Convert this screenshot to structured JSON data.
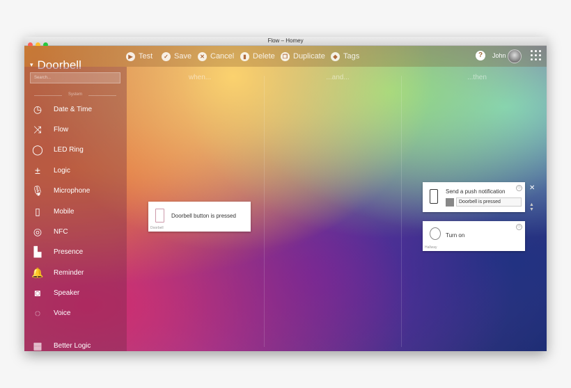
{
  "window": {
    "title": "Flow – Homey"
  },
  "header": {
    "app_name": "Doorbell"
  },
  "toolbar": [
    {
      "label": "Test",
      "icon": "play-icon",
      "glyph": "▶"
    },
    {
      "label": "Save",
      "icon": "check-icon",
      "glyph": "✓"
    },
    {
      "label": "Cancel",
      "icon": "close-icon",
      "glyph": "✕"
    },
    {
      "label": "Delete",
      "icon": "trash-icon",
      "glyph": "▮"
    },
    {
      "label": "Duplicate",
      "icon": "duplicate-icon",
      "glyph": "❐"
    },
    {
      "label": "Tags",
      "icon": "tag-icon",
      "glyph": "◆"
    }
  ],
  "user": {
    "name": "John",
    "help": "?"
  },
  "sidebar": {
    "search_placeholder": "Search...",
    "section_label": "System",
    "items": [
      {
        "label": "Date & Time",
        "icon": "clock-icon",
        "glyph": "◷"
      },
      {
        "label": "Flow",
        "icon": "flow-icon",
        "glyph": "⤨"
      },
      {
        "label": "LED Ring",
        "icon": "led-ring-icon",
        "glyph": "◯"
      },
      {
        "label": "Logic",
        "icon": "logic-icon",
        "glyph": "±"
      },
      {
        "label": "Microphone",
        "icon": "microphone-icon",
        "glyph": "🎙"
      },
      {
        "label": "Mobile",
        "icon": "mobile-icon",
        "glyph": "▯"
      },
      {
        "label": "NFC",
        "icon": "nfc-icon",
        "glyph": "◎"
      },
      {
        "label": "Presence",
        "icon": "map-icon",
        "glyph": "▙"
      },
      {
        "label": "Reminder",
        "icon": "bell-icon",
        "glyph": "🔔"
      },
      {
        "label": "Speaker",
        "icon": "speaker-icon",
        "glyph": "◙"
      },
      {
        "label": "Voice",
        "icon": "speech-bubble-icon",
        "glyph": "◌"
      },
      {
        "label": "Better Logic",
        "icon": "calculator-icon",
        "glyph": "▦"
      }
    ]
  },
  "columns": {
    "when": "when...",
    "and": "...and...",
    "then": "...then"
  },
  "cards": {
    "when": {
      "title": "Doorbell button is pressed",
      "caption": "Doorbell"
    },
    "then1": {
      "title": "Send a push notification",
      "value": "Doorbell is pressed"
    },
    "then2": {
      "title": "Turn on",
      "caption": "Hallway"
    }
  },
  "colors": {
    "accent": "#e48b3c",
    "titlebar_red": "#ff5f56",
    "titlebar_yellow": "#ffbd2e",
    "titlebar_green": "#27c93f"
  }
}
